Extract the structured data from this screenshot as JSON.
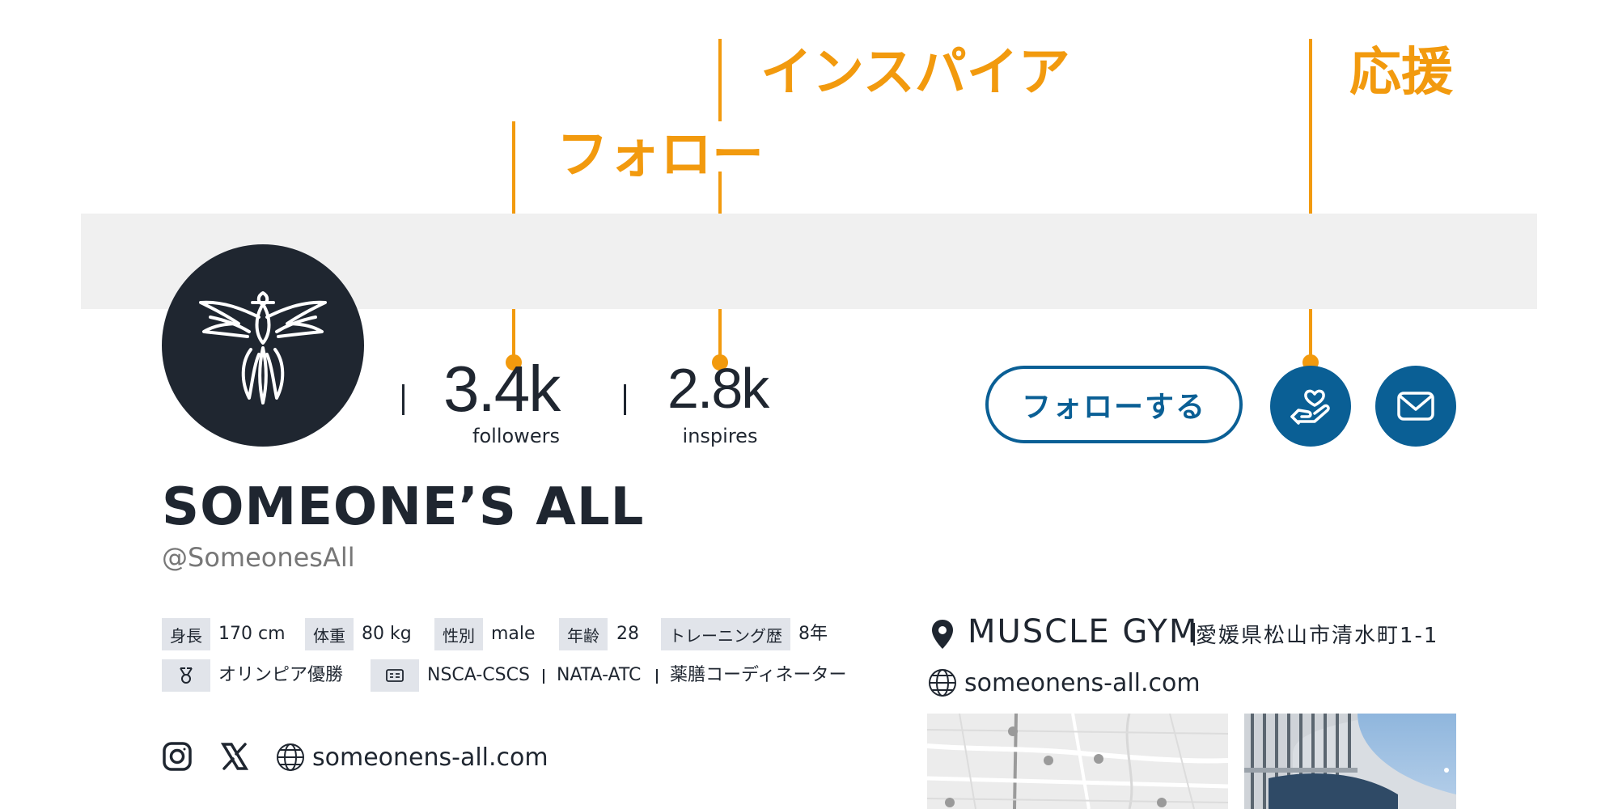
{
  "annotations": {
    "inspire": "インスパイア",
    "cheer": "応援",
    "follow": "フォロー"
  },
  "stats": {
    "followers_value": "3.4k",
    "followers_label": "followers",
    "inspires_value": "2.8k",
    "inspires_label": "inspires"
  },
  "actions": {
    "follow_label": "フォローする",
    "cheer_icon": "hand-heart-icon",
    "message_icon": "mail-icon"
  },
  "profile": {
    "name": "SOMEONE’S ALL",
    "handle": "@SomeonesAll"
  },
  "attributes": {
    "height_label": "身長",
    "height_value": "170 cm",
    "weight_label": "体重",
    "weight_value": "80 kg",
    "gender_label": "性別",
    "gender_value": "male",
    "age_label": "年齢",
    "age_value": "28",
    "training_label": "トレーニング歴",
    "training_value": "8年",
    "award": "オリンピア優勝",
    "cert_1": "NSCA-CSCS",
    "cert_2": "NATA-ATC",
    "cert_3": "薬膳コーディネーター"
  },
  "social": {
    "website": "someonens-all.com"
  },
  "gym": {
    "name": "MUSCLE GYM",
    "address": "愛媛県松山市清水町1-1",
    "website": "someonens-all.com"
  },
  "colors": {
    "accent_orange": "#f29a0e",
    "brand_blue": "#0a5f95",
    "dark": "#1f2630"
  }
}
